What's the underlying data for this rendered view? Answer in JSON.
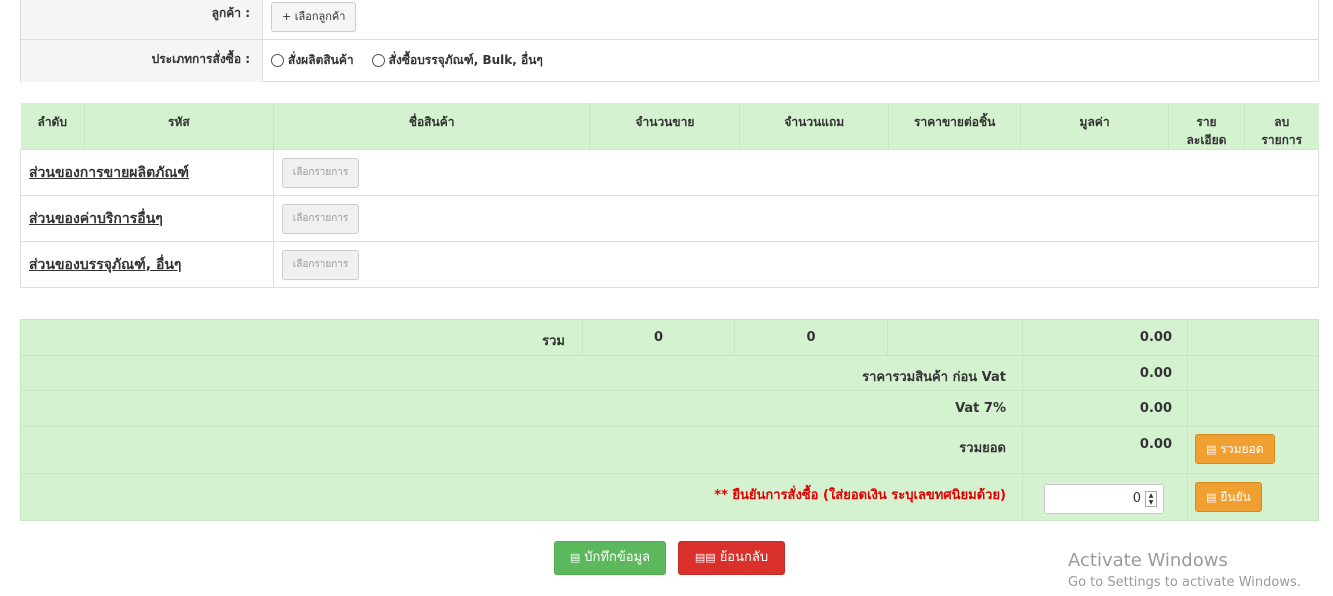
{
  "form": {
    "customer_label": "ลูกค้า :",
    "select_customer_button": "+ เลือกลูกค้า",
    "order_type_label": "ประเภทการสั่งซื้อ :",
    "order_type_options": [
      "สั่งผลิตสินค้า",
      "สั่งซื้อบรรจุภัณฑ์, Bulk, อื่นๆ"
    ]
  },
  "table": {
    "headers": {
      "no": "ลำดับ",
      "code": "รหัส",
      "name": "ชื่อสินค้า",
      "qty": "จำนวนขาย",
      "free": "จำนวนแถม",
      "price": "ราคาขายต่อชิ้น",
      "value": "มูลค่า",
      "detail_1": "ราย",
      "detail_2": "ละเอียด",
      "delete_1": "ลบ",
      "delete_2": "รายการ"
    },
    "sections": [
      {
        "label": "ส่วนของการขายผลิตภัณฑ์",
        "button": "เลือกรายการ"
      },
      {
        "label": "ส่วนของค่าบริการอื่นๆ",
        "button": "เลือกรายการ"
      },
      {
        "label": "ส่วนของบรรจุภัณฑ์, อื่นๆ",
        "button": "เลือกรายการ"
      }
    ]
  },
  "summary": {
    "total_label": "รวม",
    "total_qty": "0",
    "total_free": "0",
    "total_value": "0.00",
    "pre_vat_label": "ราคารวมสินค้า ก่อน Vat",
    "pre_vat_value": "0.00",
    "vat_label": "Vat 7%",
    "vat_value": "0.00",
    "grand_label": "รวมยอด",
    "grand_value": "0.00",
    "grand_button": "รวมยอด",
    "confirm_label": "** ยืนยันการสั่งซื้อ (ใส่ยอดเงิน ระบุเลขทศนิยมด้วย)",
    "confirm_input_value": "0",
    "confirm_button": "ยืนยัน"
  },
  "actions": {
    "save": "บักทึกข้อมูล",
    "back": "ย้อนกลับ"
  },
  "watermark": {
    "line1": "Activate Windows",
    "line2": "Go to Settings to activate Windows."
  },
  "colors": {
    "table_header_bg": "#d4f2d0",
    "orange": "#f0a030",
    "save_green": "#5cb85c",
    "back_red": "#d9302c",
    "confirm_red": "#e00000"
  }
}
